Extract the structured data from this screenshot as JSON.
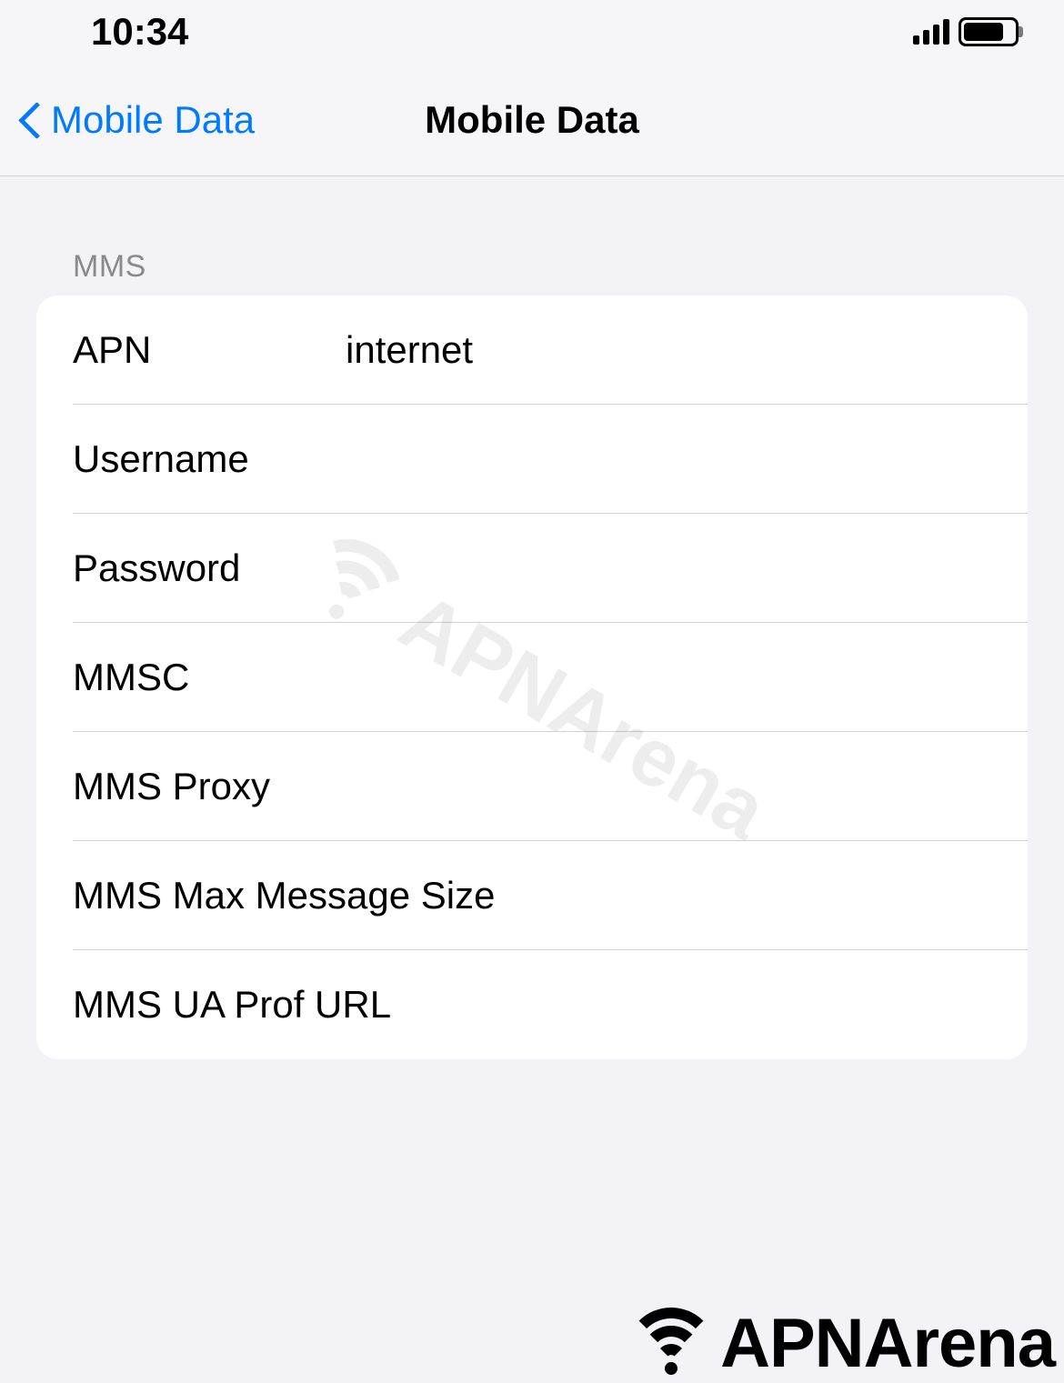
{
  "statusBar": {
    "time": "10:34"
  },
  "nav": {
    "back_label": "Mobile Data",
    "title": "Mobile Data"
  },
  "section": {
    "header": "MMS",
    "rows": [
      {
        "label": "APN",
        "value": "internet",
        "wide": false
      },
      {
        "label": "Username",
        "value": "",
        "wide": false
      },
      {
        "label": "Password",
        "value": "",
        "wide": false
      },
      {
        "label": "MMSC",
        "value": "",
        "wide": false
      },
      {
        "label": "MMS Proxy",
        "value": "",
        "wide": false
      },
      {
        "label": "MMS Max Message Size",
        "value": "",
        "wide": true
      },
      {
        "label": "MMS UA Prof URL",
        "value": "",
        "wide": true
      }
    ]
  },
  "watermark": {
    "text": "APNArena",
    "footer_text": "APNArena"
  }
}
